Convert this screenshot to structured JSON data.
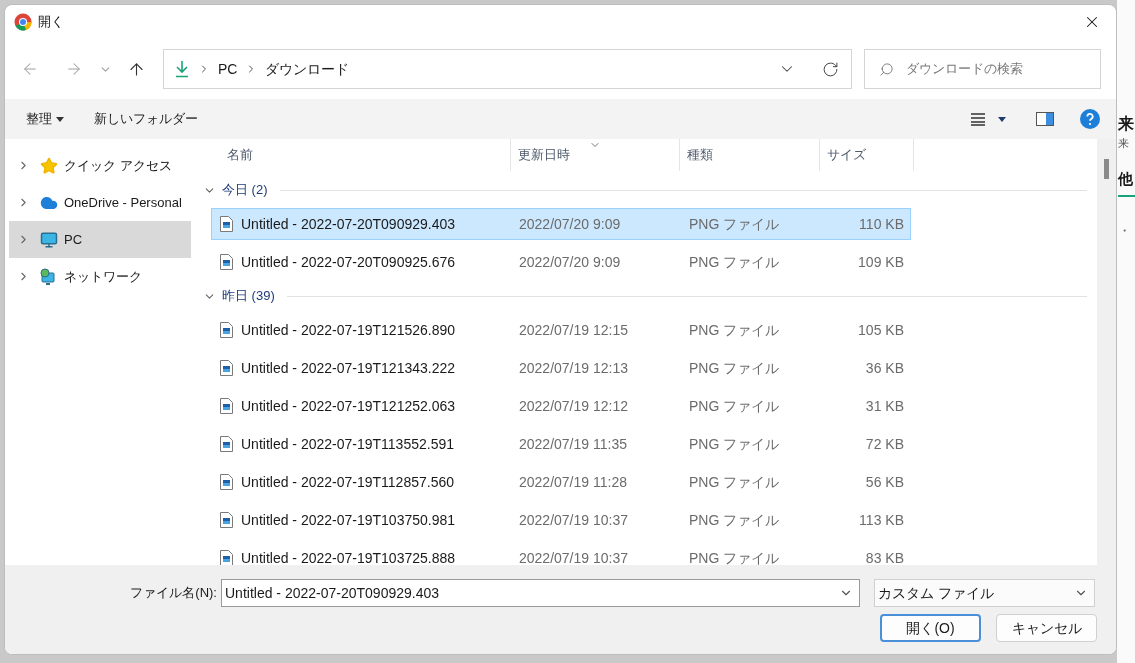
{
  "window": {
    "title": "開く"
  },
  "address": {
    "crumbs": [
      "PC",
      "ダウンロード"
    ]
  },
  "search": {
    "placeholder": "ダウンロードの検索"
  },
  "toolbar": {
    "buttons": [
      {
        "label": "整理",
        "kind": "menu"
      },
      {
        "label": "新しいフォルダー",
        "kind": "plain"
      }
    ]
  },
  "sidebar": {
    "items": [
      {
        "label": "クイック アクセス",
        "kind": "star",
        "expanded": false,
        "selected": false
      },
      {
        "label": "OneDrive - Personal",
        "kind": "cloud",
        "expanded": false,
        "selected": false
      },
      {
        "label": "PC",
        "kind": "pc",
        "expanded": false,
        "selected": true
      },
      {
        "label": "ネットワーク",
        "kind": "network",
        "expanded": false,
        "selected": false
      }
    ]
  },
  "table": {
    "columns": [
      {
        "label": "名前",
        "sorted": false
      },
      {
        "label": "更新日時",
        "sorted": true
      },
      {
        "label": "種類",
        "sorted": false
      },
      {
        "label": "サイズ",
        "sorted": false
      }
    ],
    "groups": [
      {
        "label": "今日 (2)",
        "expanded": true,
        "rows": [
          {
            "name": "Untitled - 2022-07-20T090929.403",
            "date": "2022/07/20 9:09",
            "type": "PNG ファイル",
            "size": "110 KB",
            "selected": true
          },
          {
            "name": "Untitled - 2022-07-20T090925.676",
            "date": "2022/07/20 9:09",
            "type": "PNG ファイル",
            "size": "109 KB",
            "selected": false
          }
        ]
      },
      {
        "label": "昨日 (39)",
        "expanded": true,
        "rows": [
          {
            "name": "Untitled - 2022-07-19T121526.890",
            "date": "2022/07/19 12:15",
            "type": "PNG ファイル",
            "size": "105 KB",
            "selected": false
          },
          {
            "name": "Untitled - 2022-07-19T121343.222",
            "date": "2022/07/19 12:13",
            "type": "PNG ファイル",
            "size": "36 KB",
            "selected": false
          },
          {
            "name": "Untitled - 2022-07-19T121252.063",
            "date": "2022/07/19 12:12",
            "type": "PNG ファイル",
            "size": "31 KB",
            "selected": false
          },
          {
            "name": "Untitled - 2022-07-19T113552.591",
            "date": "2022/07/19 11:35",
            "type": "PNG ファイル",
            "size": "72 KB",
            "selected": false
          },
          {
            "name": "Untitled - 2022-07-19T112857.560",
            "date": "2022/07/19 11:28",
            "type": "PNG ファイル",
            "size": "56 KB",
            "selected": false
          },
          {
            "name": "Untitled - 2022-07-19T103750.981",
            "date": "2022/07/19 10:37",
            "type": "PNG ファイル",
            "size": "113 KB",
            "selected": false
          },
          {
            "name": "Untitled - 2022-07-19T103725.888",
            "date": "2022/07/19 10:37",
            "type": "PNG ファイル",
            "size": "83 KB",
            "selected": false
          }
        ]
      }
    ]
  },
  "footer": {
    "filename_label": "ファイル名(N):",
    "filename_value": "Untitled - 2022-07-20T090929.403",
    "filetype": "カスタム ファイル",
    "buttons": [
      {
        "label": "開く(O)",
        "kind": "default"
      },
      {
        "label": "キャンセル",
        "kind": "normal"
      }
    ]
  },
  "background_page": {
    "heading": "来",
    "subheading": "来",
    "tab": "他",
    "bullet": "・"
  }
}
